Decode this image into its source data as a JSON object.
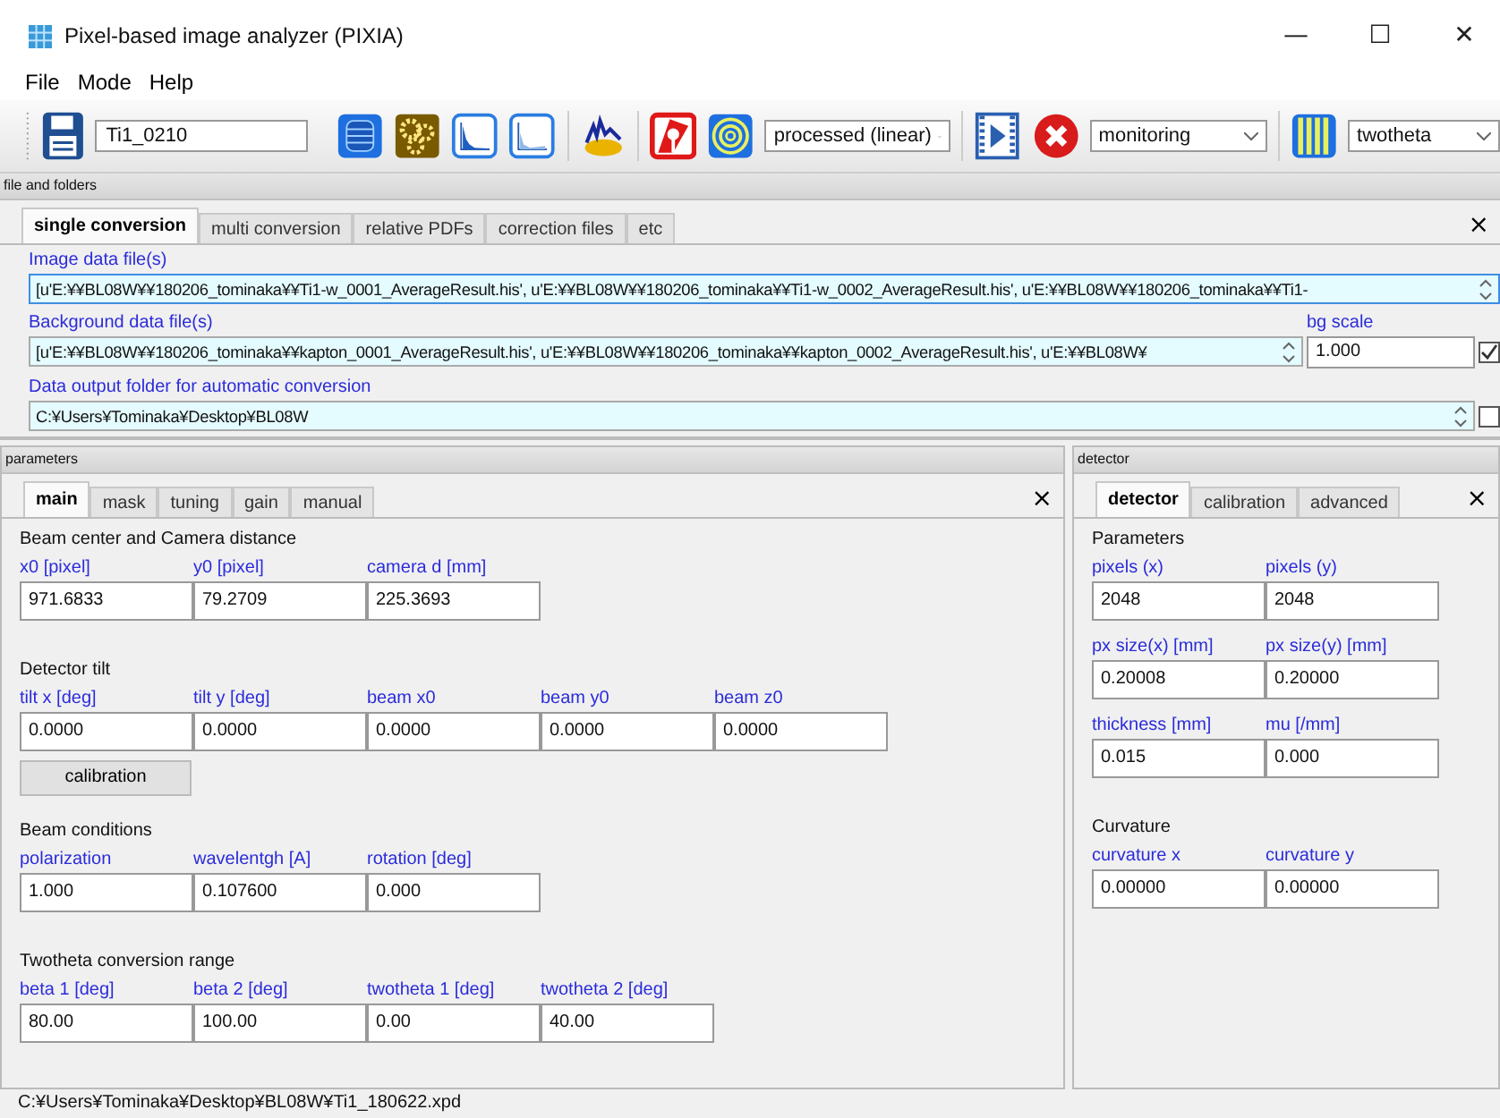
{
  "window": {
    "title": "Pixel-based image analyzer (PIXIA)",
    "controls": [
      "—",
      "☐",
      "✕"
    ]
  },
  "menu": [
    "File",
    "Mode",
    "Help"
  ],
  "toolbar": {
    "name_field": "Ti1_0210",
    "dropdowns": [
      "processed (linear)",
      "monitoring",
      "twotheta"
    ]
  },
  "file_panel": {
    "title": "file and folders",
    "close": "×",
    "tabs": [
      {
        "label": "single conversion",
        "selected": true
      },
      {
        "label": "multi conversion",
        "selected": false
      },
      {
        "label": "relative PDFs",
        "selected": false
      },
      {
        "label": "correction files",
        "selected": false
      },
      {
        "label": "etc",
        "selected": false
      }
    ],
    "image_files": {
      "label": "Image data file(s)",
      "value": "[u'E:¥¥BL08W¥¥180206_tominaka¥¥Ti1-w_0001_AverageResult.his', u'E:¥¥BL08W¥¥180206_tominaka¥¥Ti1-w_0002_AverageResult.his', u'E:¥¥BL08W¥¥180206_tominaka¥¥Ti1-"
    },
    "background_files": {
      "label": "Background data file(s)",
      "value": "[u'E:¥¥BL08W¥¥180206_tominaka¥¥kapton_0001_AverageResult.his', u'E:¥¥BL08W¥¥180206_tominaka¥¥kapton_0002_AverageResult.his', u'E:¥¥BL08W¥"
    },
    "bg_scale": {
      "label": "bg scale",
      "value": "1.000",
      "checked": true
    },
    "output_folder": {
      "label": "Data output folder for automatic conversion",
      "value": "C:¥Users¥Tominaka¥Desktop¥BL08W",
      "checked": false
    }
  },
  "parameters": {
    "title": "parameters",
    "close": "×",
    "tabs": [
      {
        "label": "main",
        "selected": true
      },
      {
        "label": "mask",
        "selected": false
      },
      {
        "label": "tuning",
        "selected": false
      },
      {
        "label": "gain",
        "selected": false
      },
      {
        "label": "manual",
        "selected": false
      }
    ],
    "sections": [
      {
        "heading": "Beam center and Camera distance",
        "fields": [
          {
            "label": "x0 [pixel]",
            "value": "971.6833"
          },
          {
            "label": "y0 [pixel]",
            "value": "79.2709"
          },
          {
            "label": "camera d [mm]",
            "value": "225.3693"
          }
        ]
      },
      {
        "heading": "Detector tilt",
        "fields": [
          {
            "label": "tilt x [deg]",
            "value": "0.0000"
          },
          {
            "label": "tilt y [deg]",
            "value": "0.0000"
          },
          {
            "label": "beam x0",
            "value": "0.0000"
          },
          {
            "label": "beam y0",
            "value": "0.0000"
          },
          {
            "label": "beam z0",
            "value": "0.0000"
          }
        ],
        "button": "calibration"
      },
      {
        "heading": "Beam conditions",
        "fields": [
          {
            "label": "polarization",
            "value": "1.000"
          },
          {
            "label": "wavelentgh [A]",
            "value": "0.107600"
          },
          {
            "label": "rotation [deg]",
            "value": "0.000"
          }
        ]
      },
      {
        "heading": "Twotheta conversion range",
        "fields": [
          {
            "label": "beta 1 [deg]",
            "value": "80.00"
          },
          {
            "label": "beta 2 [deg]",
            "value": "100.00"
          },
          {
            "label": "twotheta 1 [deg]",
            "value": "0.00"
          },
          {
            "label": "twotheta 2 [deg]",
            "value": "40.00"
          }
        ]
      }
    ]
  },
  "detector": {
    "title": "detector",
    "close": "×",
    "tabs": [
      {
        "label": "detector",
        "selected": true
      },
      {
        "label": "calibration",
        "selected": false
      },
      {
        "label": "advanced",
        "selected": false
      }
    ],
    "sections": [
      {
        "heading": "Parameters",
        "fields": [
          {
            "label": "pixels (x)",
            "value": "2048"
          },
          {
            "label": "pixels (y)",
            "value": "2048"
          },
          {
            "label": "px size(x) [mm]",
            "value": "0.20008"
          },
          {
            "label": "px size(y) [mm]",
            "value": "0.20000"
          },
          {
            "label": "thickness [mm]",
            "value": "0.015"
          },
          {
            "label": "mu [/mm]",
            "value": "0.000"
          }
        ]
      },
      {
        "heading": "Curvature",
        "fields": [
          {
            "label": "curvature x",
            "value": "0.00000"
          },
          {
            "label": "curvature y",
            "value": "0.00000"
          }
        ]
      }
    ]
  },
  "status_bar": "C:¥Users¥Tominaka¥Desktop¥BL08W¥Ti1_180622.xpd"
}
